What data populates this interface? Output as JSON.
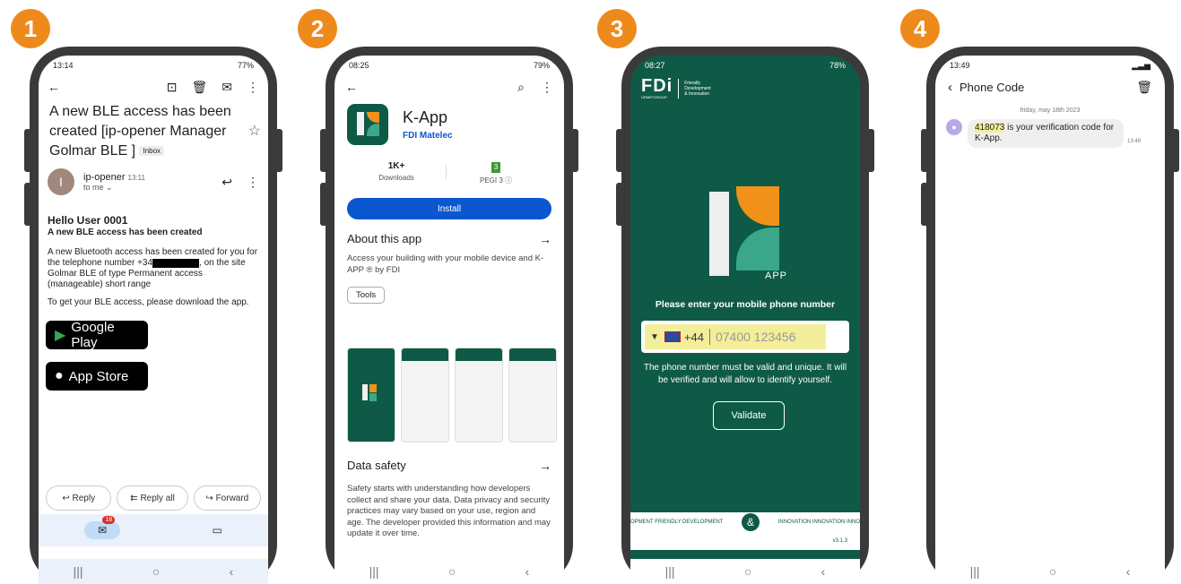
{
  "steps": [
    "1",
    "2",
    "3",
    "4"
  ],
  "phone1": {
    "status_time": "13:14",
    "status_battery": "77%",
    "subject": "A new BLE access has been created [ip-opener Manager Golmar BLE ]",
    "inbox_tag": "Inbox",
    "avatar_letter": "I",
    "sender": "ip-opener",
    "sender_time": "13:11",
    "to": "to me",
    "greeting": "Hello User 0001",
    "headline": "A new BLE access has been created",
    "para1_a": "A new Bluetooth access has been created for you for the telephone number +34",
    "para1_b": ", on the site  Golmar BLE  of type Permanent access (manageable) short range",
    "para2": "To get your BLE access, please download the app.",
    "google_play": "Google Play",
    "app_store": "App Store",
    "reply": "Reply",
    "reply_all": "Reply all",
    "forward": "Forward",
    "mail_count": "18"
  },
  "phone2": {
    "status_time": "08:25",
    "status_battery": "79%",
    "app_name": "K-App",
    "developer": "FDI Matelec",
    "downloads_value": "1K+",
    "downloads_label": "Downloads",
    "pegi_value": "3",
    "pegi_label": "PEGI 3 ⓘ",
    "install": "Install",
    "about_title": "About this app",
    "about_text": "Access your building with your mobile device and K-APP ® by FDI",
    "tag": "Tools",
    "safety_title": "Data safety",
    "safety_text": "Safety starts with understanding how developers collect and share your data. Data privacy and security practices may vary based on your use, region and age. The developer provided this information and may update it over time."
  },
  "phone3": {
    "status_time": "08:27",
    "status_battery": "78%",
    "logo": "FDi",
    "logo_sub1": "Friendly",
    "logo_sub2": "Development",
    "logo_sub3": "& Innovation",
    "logo_group": "URMETGROUP",
    "app_label": "APP",
    "prompt": "Please enter your mobile phone number",
    "country_code": "+44",
    "phone_number": "07400 123456",
    "info": "The phone number must be valid and unique. It will be verified and will allow to identify yourself.",
    "validate": "Validate",
    "ticker": "OPMENT  FRIENDLY DEVELOPMENT",
    "ticker_right": "INNOVATION   INNOVATION  INNO",
    "amp": "&",
    "version": "v3.1.3"
  },
  "phone4": {
    "status_time": "13:49",
    "title": "Phone Code",
    "date": "friday, may 18th 2023",
    "code": "418073",
    "message_rest": " is your verification code for K-App.",
    "msg_time": "13:49"
  },
  "colors": {
    "badge": "#ee8a1c",
    "fdi_green": "#0e5a46",
    "play_blue": "#0b57d0",
    "highlight": "#f3ee9a"
  }
}
